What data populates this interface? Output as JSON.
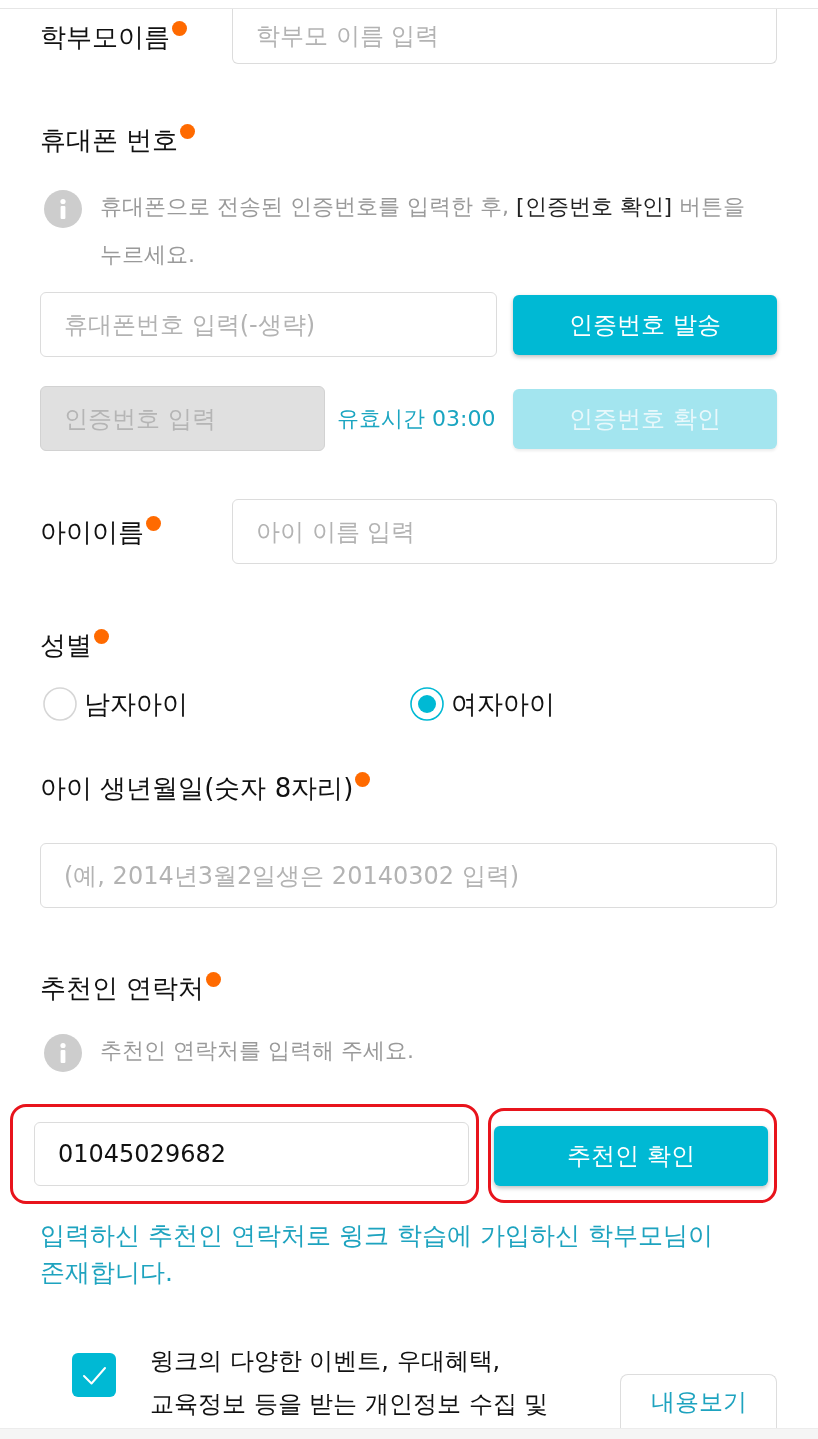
{
  "parent_name": {
    "label": "학부모이름",
    "required": true,
    "placeholder": "학부모 이름 입력"
  },
  "phone": {
    "label": "휴대폰 번호",
    "required": true,
    "info": "휴대폰으로 전송된 인증번호를 입력한 후, **[인증번호 확인]** 버튼을 누르세요.",
    "number_field": {
      "placeholder": "휴대폰번호 입력(-생략)"
    },
    "send_button": {
      "label": "인증번호 발송",
      "disabled": false
    },
    "code_field": {
      "placeholder": "인증번호 입력",
      "disabled": true
    },
    "timer": "유효시간 03:00",
    "confirm_button": {
      "label": "인증번호 확인",
      "disabled": true
    }
  },
  "child_name": {
    "label": "아이이름",
    "required": true,
    "placeholder": "아이 이름 입력"
  },
  "gender": {
    "label": "성별",
    "required": true,
    "options": [
      {
        "label": "남자아이",
        "selected": false
      },
      {
        "label": "여자아이",
        "selected": true
      }
    ]
  },
  "birth_date": {
    "label": "아이 생년월일(숫자 8자리)",
    "required": true,
    "placeholder": "(예, 2014년3월2일생은 20140302 입력)"
  },
  "referrer": {
    "label": "추천인 연락처",
    "required": true,
    "info": "추천인 연락처를 입력해 주세요.",
    "field": {
      "value": "01045029682",
      "highlighted": true
    },
    "button": {
      "label": "추천인 확인",
      "highlighted": true
    },
    "message": "입력하신 추천인 연락처로 윙크 학습에 가입하신 학부모님이 존재합니다."
  },
  "consent": {
    "checked": true,
    "text": "윙크의 다양한 이벤트, 우대혜택, 교육정보 등을 받는 개인정보 수집 및",
    "button": "내용보기"
  }
}
